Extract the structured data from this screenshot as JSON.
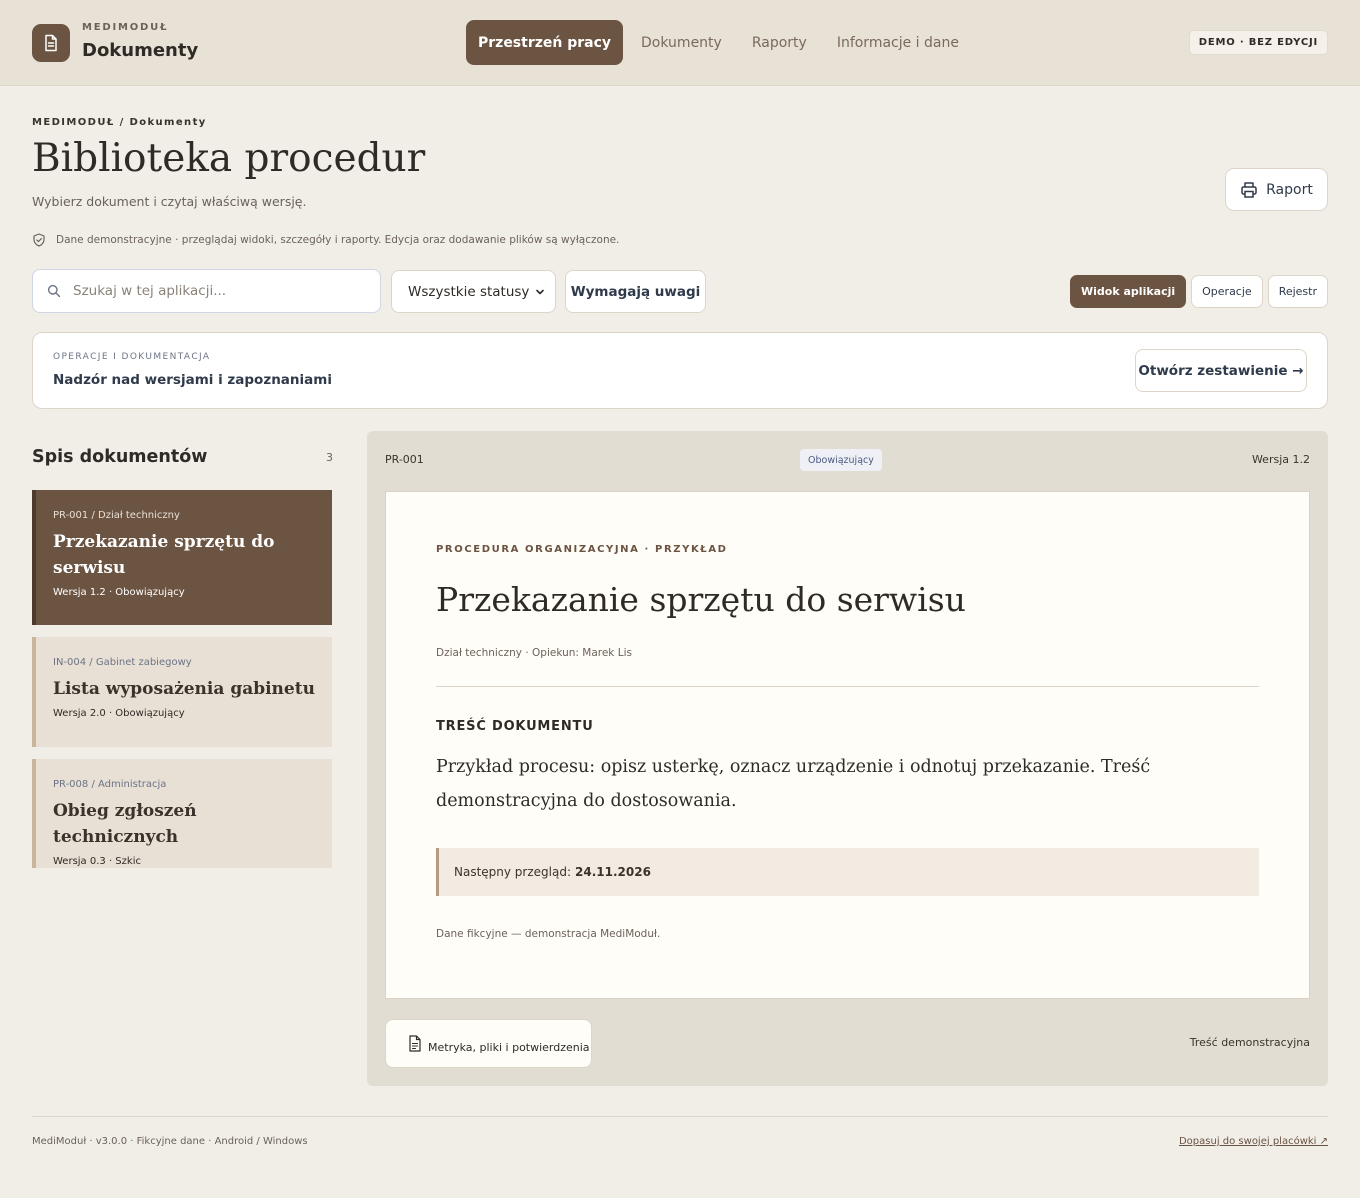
{
  "app": {
    "brand_small": "MEDIMODUŁ",
    "brand_title": "Dokumenty",
    "logo_icon": "document-icon",
    "accent_color": "#6c5443"
  },
  "nav": {
    "items": [
      {
        "label": "Przestrzeń pracy",
        "active": true
      },
      {
        "label": "Dokumenty",
        "active": false
      },
      {
        "label": "Raporty",
        "active": false
      },
      {
        "label": "Informacje i dane",
        "active": false
      }
    ],
    "demo_badge": "DEMO · BEZ EDYCJI"
  },
  "page": {
    "breadcrumb": "MEDIMODUŁ / Dokumenty",
    "title": "Biblioteka procedur",
    "subtitle": "Wybierz dokument i czytaj właściwą wersję.",
    "report_button": "Raport",
    "notice": "Dane demonstracyjne · przeglądaj widoki, szczegóły i raporty. Edycja oraz dodawanie plików są wyłączone."
  },
  "toolbar": {
    "search_placeholder": "Szukaj w tej aplikacji...",
    "status_select_value": "Wszystkie statusy",
    "attention_button": "Wymagają uwagi",
    "views": [
      {
        "label": "Widok aplikacji",
        "active": true
      },
      {
        "label": "Operacje",
        "active": false
      },
      {
        "label": "Rejestr",
        "active": false
      }
    ]
  },
  "ops_card": {
    "kicker": "OPERACJE I DOKUMENTACJA",
    "title": "Nadzór nad wersjami i zapoznaniami",
    "button": "Otwórz zestawienie →"
  },
  "doc_list": {
    "heading": "Spis dokumentów",
    "count": "3",
    "items": [
      {
        "code": "PR-001 / Dział techniczny",
        "title": "Przekazanie sprzętu do serwisu",
        "meta": "Wersja 1.2 · Obowiązujący",
        "active": true
      },
      {
        "code": "IN-004 / Gabinet zabiegowy",
        "title": "Lista wyposażenia gabinetu",
        "meta": "Wersja 2.0 · Obowiązujący",
        "active": false
      },
      {
        "code": "PR-008 / Administracja",
        "title": "Obieg zgłoszeń technicznych",
        "meta": "Wersja 0.3 · Szkic",
        "active": false
      }
    ]
  },
  "viewer": {
    "code": "PR-001",
    "status": "Obowiązujący",
    "version": "Wersja 1.2",
    "paper": {
      "kicker": "PROCEDURA ORGANIZACYJNA · PRZYKŁAD",
      "title": "Przekazanie sprzętu do serwisu",
      "meta": "Dział techniczny · Opiekun: Marek Lis",
      "section": "TREŚĆ DOKUMENTU",
      "body": "Przykład procesu: opisz usterkę, oznacz urządzenie i odnotuj przekazanie. Treść demonstracyjna do dostosowania.",
      "review_label": "Następny przegląd:",
      "review_date": "24.11.2026",
      "footnote": "Dane fikcyjne — demonstracja MediModuł."
    },
    "meta_button": "Metryka, pliki i potwierdzenia",
    "demo_note": "Treść demonstracyjna"
  },
  "footer": {
    "left": "MediModuł · v3.0.0 · Fikcyjne dane · Android / Windows",
    "right": "Dopasuj do swojej placówki ↗"
  }
}
